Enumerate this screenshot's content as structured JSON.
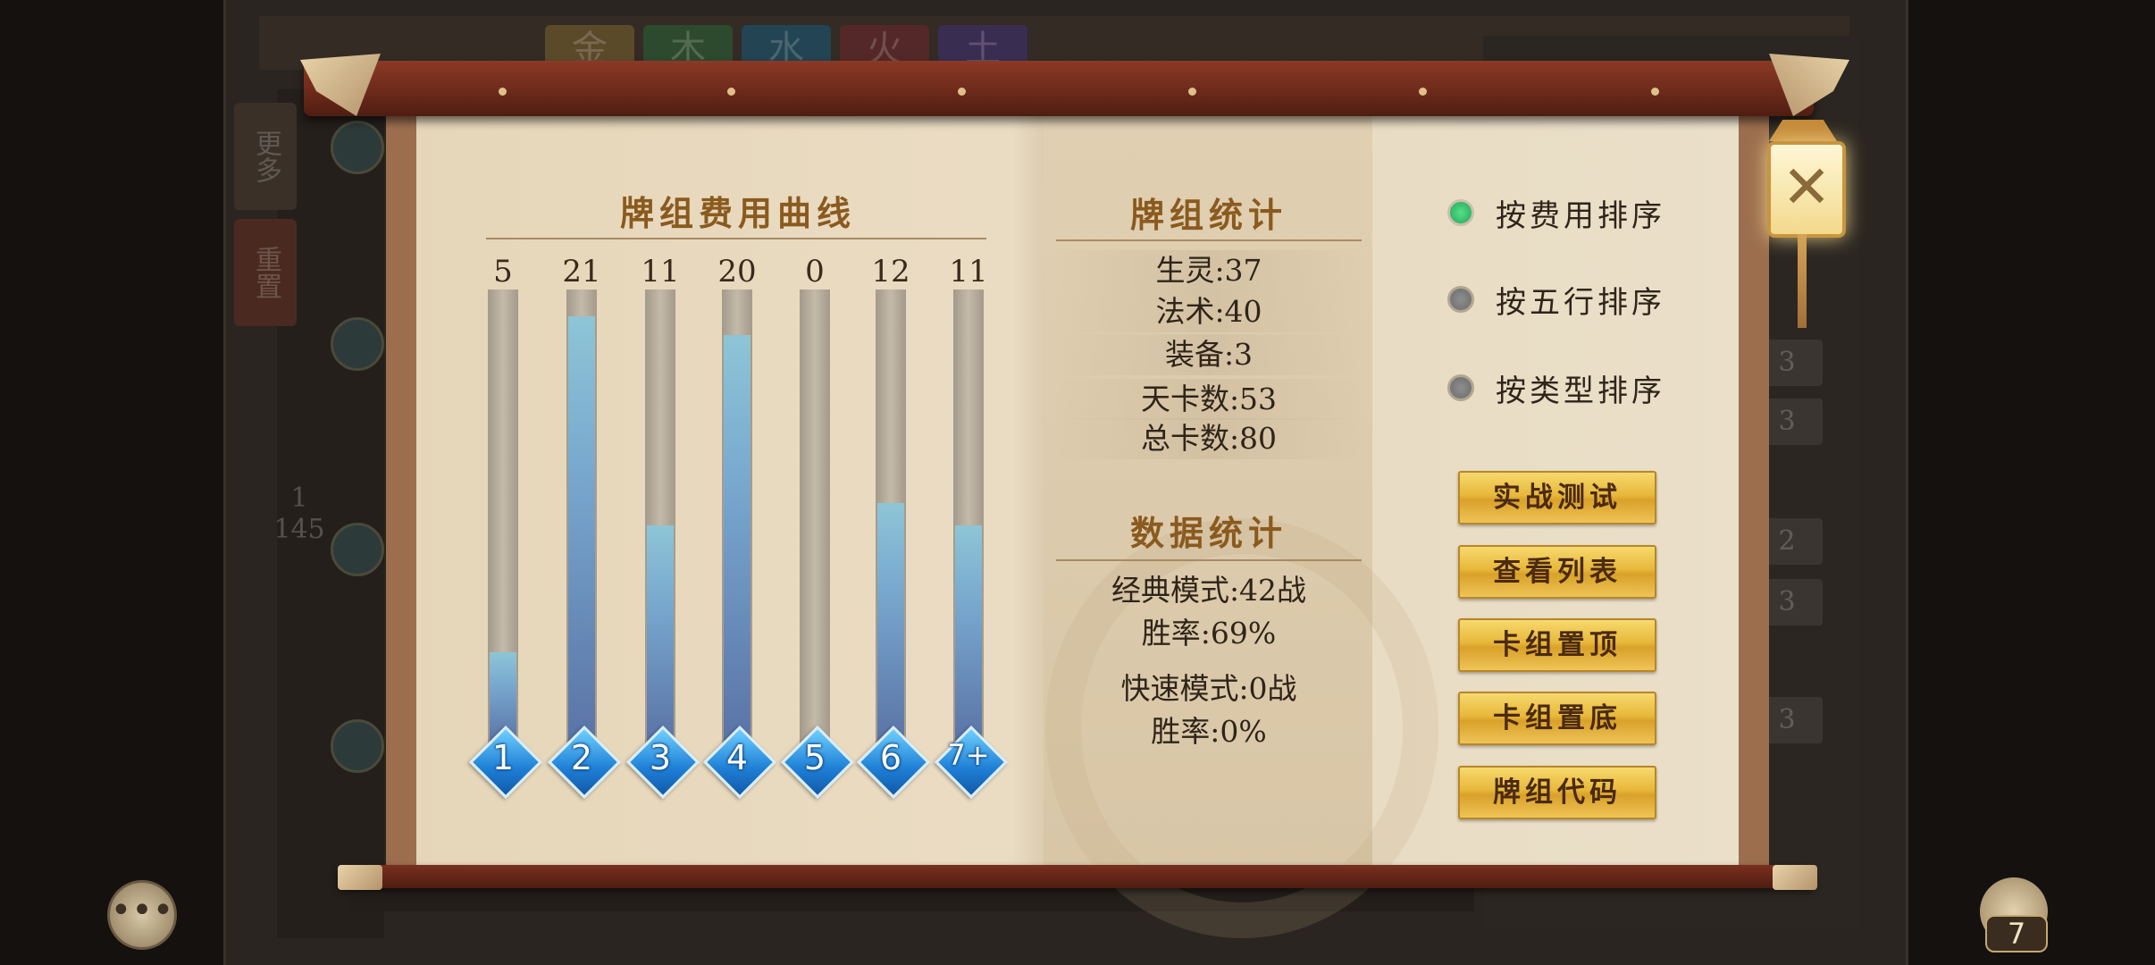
{
  "background": {
    "element_tabs": [
      "金",
      "木",
      "水",
      "火",
      "土"
    ],
    "side_tab_more": "更多",
    "side_tab_reset": "重置",
    "page_current": "1",
    "page_total": "145",
    "row_counts": [
      "3",
      "3",
      "3",
      "2",
      "3",
      "3"
    ]
  },
  "cost_curve": {
    "title": "牌组费用曲线",
    "bars": [
      {
        "cost": "1",
        "count": "5",
        "fill": 0.2
      },
      {
        "cost": "2",
        "count": "21",
        "fill": 0.94
      },
      {
        "cost": "3",
        "count": "11",
        "fill": 0.48
      },
      {
        "cost": "4",
        "count": "20",
        "fill": 0.9
      },
      {
        "cost": "5",
        "count": "0",
        "fill": 0.0
      },
      {
        "cost": "6",
        "count": "12",
        "fill": 0.53
      },
      {
        "cost": "7+",
        "count": "11",
        "fill": 0.48
      }
    ]
  },
  "deck_stats": {
    "title": "牌组统计",
    "creature": "生灵:37",
    "spell": "法术:40",
    "equipment": "装备:3",
    "heaven_cards": "天卡数:53",
    "total_cards": "总卡数:80"
  },
  "data_stats": {
    "title": "数据统计",
    "classic_mode": "经典模式:42战",
    "classic_winrate": "胜率:69%",
    "quick_mode": "快速模式:0战",
    "quick_winrate": "胜率:0%"
  },
  "sort_options": [
    {
      "label": "按费用排序",
      "selected": true
    },
    {
      "label": "按五行排序",
      "selected": false
    },
    {
      "label": "按类型排序",
      "selected": false
    }
  ],
  "actions": {
    "battle_test": "实战测试",
    "view_list": "查看列表",
    "pin_top": "卡组置顶",
    "pin_bottom": "卡组置底",
    "deck_code": "牌组代码"
  },
  "close_glyph": "✕",
  "chat_glyph": "•••",
  "bag_count": "7",
  "colors": {
    "title_brown": "#8a5a1e",
    "bar_blue": "#5a73a6",
    "gem_blue": "#1e7fd6",
    "gold_button": "#e7b83a",
    "radio_on": "#23a55a"
  }
}
